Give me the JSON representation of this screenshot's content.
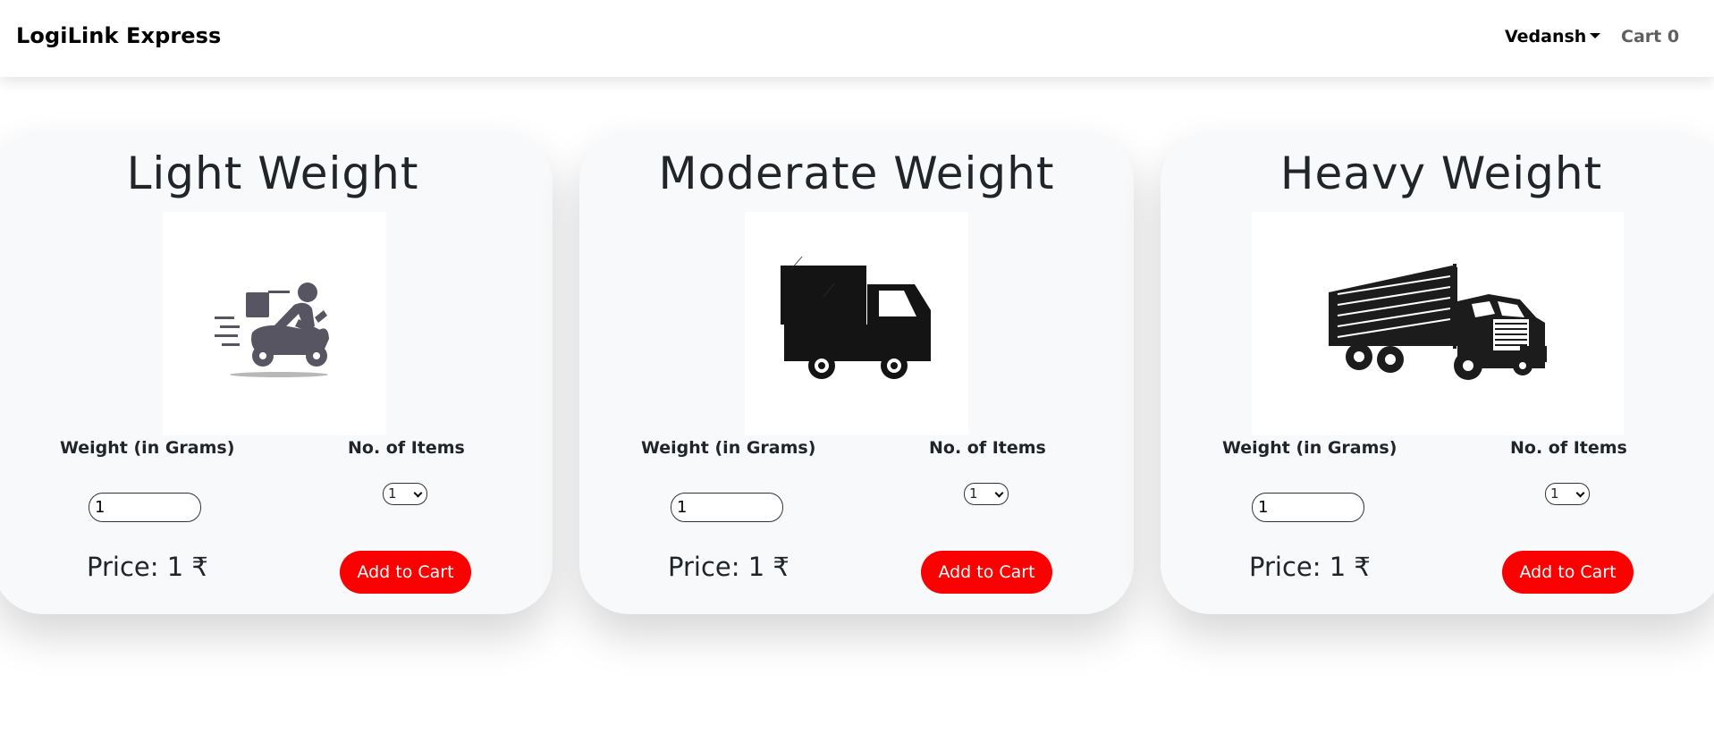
{
  "navbar": {
    "brand": "LogiLink Express",
    "user_name": "Vedansh",
    "cart_label": "Cart",
    "cart_count": "0"
  },
  "cards": [
    {
      "title": "Light Weight",
      "icon": "scooter-delivery-icon",
      "weight_label": "Weight (in Grams)",
      "items_label": "No. of Items",
      "weight_value": "1",
      "items_value": "1",
      "price_text": "Price: 1 ₹",
      "button_label": "Add to Cart"
    },
    {
      "title": "Moderate Weight",
      "icon": "truck-icon",
      "weight_label": "Weight (in Grams)",
      "items_label": "No. of Items",
      "weight_value": "1",
      "items_value": "1",
      "price_text": "Price: 1 ₹",
      "button_label": "Add to Cart"
    },
    {
      "title": "Heavy Weight",
      "icon": "lorry-icon",
      "weight_label": "Weight (in Grams)",
      "items_label": "No. of Items",
      "weight_value": "1",
      "items_value": "1",
      "price_text": "Price: 1 ₹",
      "button_label": "Add to Cart"
    }
  ],
  "colors": {
    "accent": "#fb0000",
    "card_bg": "#f8f9fa",
    "text": "#212529"
  }
}
